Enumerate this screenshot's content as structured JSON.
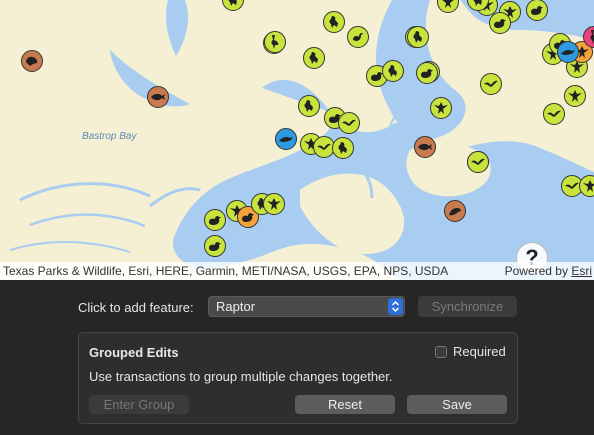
{
  "map": {
    "attribution": "Texas Parks & Wildlife, Esri, HERE, Garmin, METI/NASA, USGS, EPA, NPS, USDA",
    "powered_by": "Powered by",
    "powered_by_link": "Esri",
    "help_label": "?",
    "labels": {
      "bay": "Bastrop Bay"
    },
    "colors": {
      "land": "#f5f0d3",
      "water": "#a8cdf0",
      "green": "#c8e33c",
      "brown": "#c97a4e",
      "blue": "#2e9be0",
      "orange": "#f5a23a",
      "pink": "#e8417c"
    },
    "features": [
      {
        "type": "bird-standing",
        "color": "green"
      },
      {
        "type": "heron",
        "color": "green"
      },
      {
        "type": "bird-standing",
        "color": "green"
      },
      {
        "type": "swan",
        "color": "green"
      },
      {
        "type": "bird-standing",
        "color": "green"
      },
      {
        "type": "eagle",
        "color": "green"
      },
      {
        "type": "raptor",
        "color": "green"
      },
      {
        "type": "duck",
        "color": "green"
      },
      {
        "type": "bird-standing",
        "color": "green"
      },
      {
        "type": "raptor",
        "color": "green"
      },
      {
        "type": "bird-flying",
        "color": "green"
      },
      {
        "type": "turtle",
        "color": "brown"
      },
      {
        "type": "fish",
        "color": "brown"
      },
      {
        "type": "dolphin",
        "color": "blue"
      },
      {
        "type": "bird-standing",
        "color": "green"
      },
      {
        "type": "duck",
        "color": "green"
      },
      {
        "type": "bird-flying",
        "color": "green"
      },
      {
        "type": "raptor",
        "color": "green"
      },
      {
        "type": "bird-flying",
        "color": "green"
      },
      {
        "type": "bird-standing",
        "color": "green"
      },
      {
        "type": "raptor",
        "color": "green"
      },
      {
        "type": "fish",
        "color": "brown"
      },
      {
        "type": "seal",
        "color": "brown"
      },
      {
        "type": "bird-flying",
        "color": "green"
      },
      {
        "type": "raptor",
        "color": "green"
      },
      {
        "type": "bird-flying",
        "color": "green"
      },
      {
        "type": "duck",
        "color": "green"
      },
      {
        "type": "raptor",
        "color": "green"
      },
      {
        "type": "duck",
        "color": "green"
      },
      {
        "type": "heron",
        "color": "green"
      },
      {
        "type": "duck",
        "color": "green"
      },
      {
        "type": "raptor",
        "color": "green"
      },
      {
        "type": "duck",
        "color": "orange"
      },
      {
        "type": "bird-standing",
        "color": "green"
      },
      {
        "type": "raptor",
        "color": "green"
      },
      {
        "type": "duck",
        "color": "green"
      },
      {
        "type": "raptor",
        "color": "green"
      },
      {
        "type": "raptor",
        "color": "green"
      },
      {
        "type": "duck",
        "color": "green"
      },
      {
        "type": "raptor",
        "color": "orange"
      },
      {
        "type": "dolphin",
        "color": "blue"
      },
      {
        "type": "raptor",
        "color": "green"
      },
      {
        "type": "raptor",
        "color": "green"
      },
      {
        "type": "raptor",
        "color": "green"
      },
      {
        "type": "bird-standing",
        "color": "green"
      },
      {
        "type": "bird-flying",
        "color": "green"
      },
      {
        "type": "heron",
        "color": "pink"
      },
      {
        "type": "bird-standing",
        "color": "green"
      },
      {
        "type": "duck",
        "color": "green"
      }
    ]
  },
  "panel": {
    "click_label": "Click to add feature:",
    "feature_select_value": "Raptor",
    "synchronize_label": "Synchronize",
    "group": {
      "title": "Grouped Edits",
      "required_label": "Required",
      "description": "Use transactions to group multiple changes together.",
      "enter_group_label": "Enter Group",
      "reset_label": "Reset",
      "save_label": "Save"
    }
  }
}
